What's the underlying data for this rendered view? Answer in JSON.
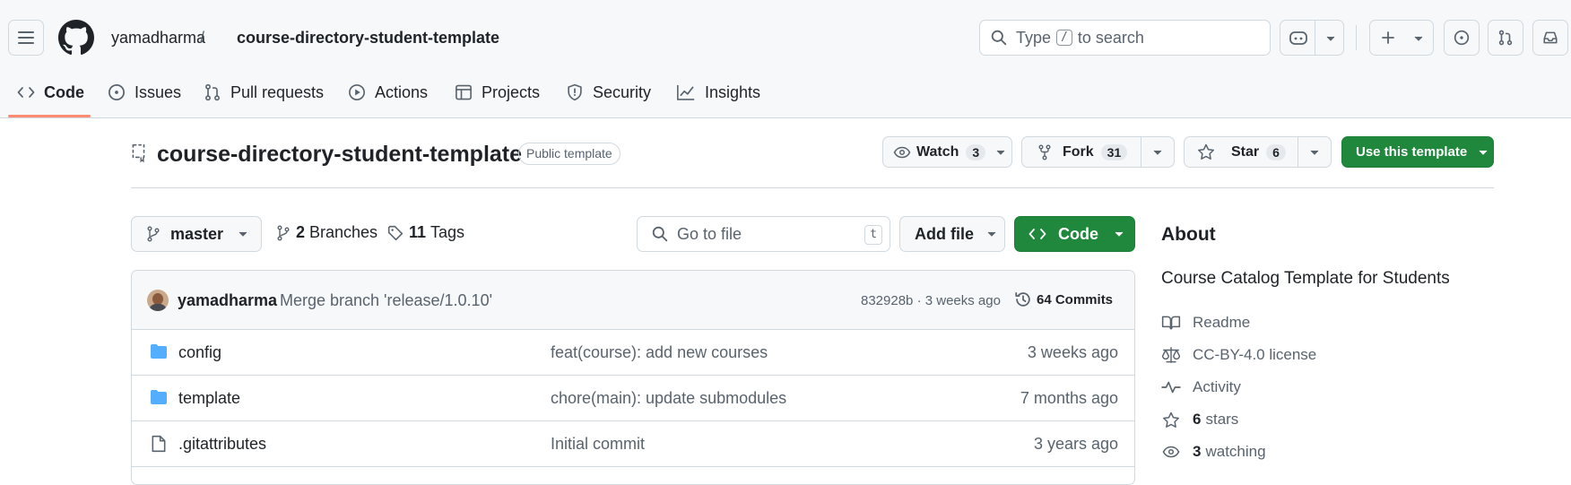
{
  "header": {
    "owner": "yamadharma",
    "separator": "/",
    "repo": "course-directory-student-template",
    "search_prefix": "Type",
    "search_key": "/",
    "search_suffix": "to search"
  },
  "nav_tabs": [
    {
      "label": "Code",
      "icon": "code-icon"
    },
    {
      "label": "Issues",
      "icon": "issue-icon"
    },
    {
      "label": "Pull requests",
      "icon": "pull-request-icon"
    },
    {
      "label": "Actions",
      "icon": "play-icon"
    },
    {
      "label": "Projects",
      "icon": "table-icon"
    },
    {
      "label": "Security",
      "icon": "shield-icon"
    },
    {
      "label": "Insights",
      "icon": "graph-icon"
    }
  ],
  "repo_header": {
    "name": "course-directory-student-template",
    "badge": "Public template",
    "watch_label": "Watch",
    "watch_count": "3",
    "fork_label": "Fork",
    "fork_count": "31",
    "star_label": "Star",
    "star_count": "6",
    "use_template_label": "Use this template"
  },
  "toolbar": {
    "branch": "master",
    "branches_count": "2",
    "branches_label": "Branches",
    "tags_count": "11",
    "tags_label": "Tags",
    "go_to_file_placeholder": "Go to file",
    "go_to_file_key": "t",
    "add_file_label": "Add file",
    "code_label": "Code"
  },
  "latest_commit": {
    "author": "yamadharma",
    "message": "Merge branch 'release/1.0.10'",
    "hash_age": "832928b · 3 weeks ago",
    "commits_label": "64 Commits"
  },
  "files": [
    {
      "name": "config",
      "type": "folder",
      "message": "feat(course): add new courses",
      "age": "3 weeks ago"
    },
    {
      "name": "template",
      "type": "folder",
      "message": "chore(main): update submodules",
      "age": "7 months ago"
    },
    {
      "name": ".gitattributes",
      "type": "file",
      "message": "Initial commit",
      "age": "3 years ago"
    }
  ],
  "about": {
    "heading": "About",
    "description": "Course Catalog Template for Students",
    "readme": "Readme",
    "license": "CC-BY-4.0 license",
    "activity": "Activity",
    "stars_count": "6",
    "stars_label": "stars",
    "watching_count": "3",
    "watching_label": "watching"
  },
  "colors": {
    "accent_green": "#1f883d",
    "tab_underline": "#fd8c73",
    "folder_blue": "#54aeff"
  }
}
